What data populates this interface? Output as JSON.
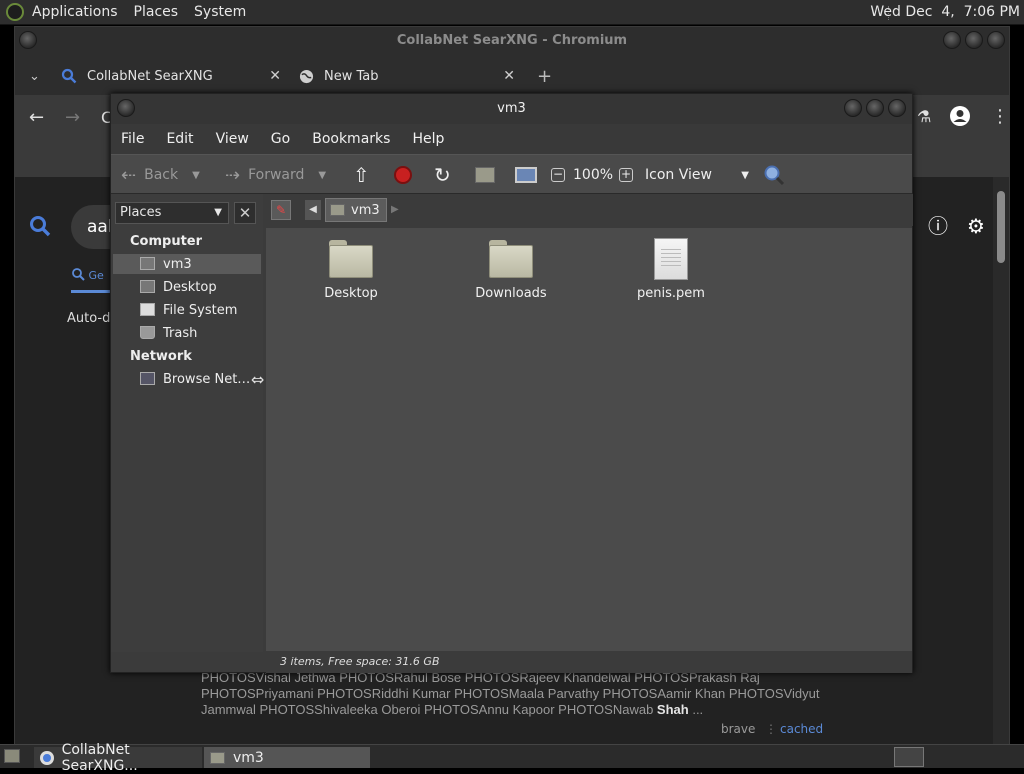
{
  "top_panel": {
    "menus": [
      "Applications",
      "Places",
      "System"
    ],
    "clock": "Wed Dec  4,  7:06 PM"
  },
  "browser": {
    "window_title": "CollabNet SearXNG - Chromium",
    "tabs": [
      {
        "label": "CollabNet SearXNG",
        "icon": "search-icon",
        "active": true
      },
      {
        "label": "New Tab",
        "icon": "globe-icon",
        "active": false
      }
    ],
    "address_partial": "C",
    "search_query_partial": "aah",
    "category_partial": "Ge",
    "autodetect_partial": "Auto-de",
    "result": {
      "snippet_lines": [
        "PHOTOSVishal Jethwa PHOTOSRahul Bose PHOTOSRajeev Khandelwal PHOTOSPrakash Raj",
        "PHOTOSPriyamani PHOTOSRiddhi Kumar PHOTOSMaala Parvathy PHOTOSAamir Khan PHOTOSVidyut",
        "Jammwal PHOTOSShivaleeka Oberoi PHOTOSAnnu Kapoor PHOTOSNawab"
      ],
      "snippet_bold": "Shah",
      "snippet_tail": " ...",
      "engine": "brave",
      "cached": "cached"
    }
  },
  "file_manager": {
    "title": "vm3",
    "menu": [
      "File",
      "Edit",
      "View",
      "Go",
      "Bookmarks",
      "Help"
    ],
    "toolbar": {
      "back": "Back",
      "forward": "Forward",
      "zoom": "100%",
      "view_mode": "Icon View"
    },
    "sidebar": {
      "selector": "Places",
      "headers": {
        "computer": "Computer",
        "network": "Network"
      },
      "computer_items": [
        "vm3",
        "Desktop",
        "File System",
        "Trash"
      ],
      "network_items": [
        "Browse Net…"
      ]
    },
    "path": "vm3",
    "items": [
      {
        "name": "Desktop",
        "type": "folder"
      },
      {
        "name": "Downloads",
        "type": "folder"
      },
      {
        "name": "penis.pem",
        "type": "file"
      }
    ],
    "status": "3 items, Free space: 31.6 GB"
  },
  "taskbar": {
    "items": [
      "CollabNet SearXNG...",
      "vm3"
    ]
  }
}
